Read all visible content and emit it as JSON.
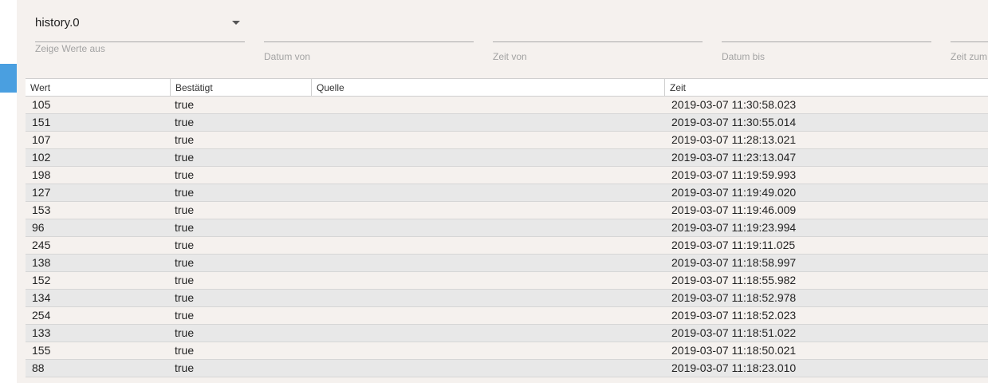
{
  "filters": {
    "history_select": {
      "value": "history.0",
      "label": "Zeige Werte aus"
    },
    "date_from_label": "Datum von",
    "time_from_label": "Zeit von",
    "date_to_label": "Datum bis",
    "time_to_label": "Zeit zum"
  },
  "table": {
    "headers": {
      "wert": "Wert",
      "bestaetigt": "Bestätigt",
      "quelle": "Quelle",
      "zeit": "Zeit"
    },
    "rows": [
      {
        "wert": "105",
        "bestaetigt": "true",
        "quelle": "",
        "zeit": "2019-03-07 11:30:58.023"
      },
      {
        "wert": "151",
        "bestaetigt": "true",
        "quelle": "",
        "zeit": "2019-03-07 11:30:55.014"
      },
      {
        "wert": "107",
        "bestaetigt": "true",
        "quelle": "",
        "zeit": "2019-03-07 11:28:13.021"
      },
      {
        "wert": "102",
        "bestaetigt": "true",
        "quelle": "",
        "zeit": "2019-03-07 11:23:13.047"
      },
      {
        "wert": "198",
        "bestaetigt": "true",
        "quelle": "",
        "zeit": "2019-03-07 11:19:59.993"
      },
      {
        "wert": "127",
        "bestaetigt": "true",
        "quelle": "",
        "zeit": "2019-03-07 11:19:49.020"
      },
      {
        "wert": "153",
        "bestaetigt": "true",
        "quelle": "",
        "zeit": "2019-03-07 11:19:46.009"
      },
      {
        "wert": "96",
        "bestaetigt": "true",
        "quelle": "",
        "zeit": "2019-03-07 11:19:23.994"
      },
      {
        "wert": "245",
        "bestaetigt": "true",
        "quelle": "",
        "zeit": "2019-03-07 11:19:11.025"
      },
      {
        "wert": "138",
        "bestaetigt": "true",
        "quelle": "",
        "zeit": "2019-03-07 11:18:58.997"
      },
      {
        "wert": "152",
        "bestaetigt": "true",
        "quelle": "",
        "zeit": "2019-03-07 11:18:55.982"
      },
      {
        "wert": "134",
        "bestaetigt": "true",
        "quelle": "",
        "zeit": "2019-03-07 11:18:52.978"
      },
      {
        "wert": "254",
        "bestaetigt": "true",
        "quelle": "",
        "zeit": "2019-03-07 11:18:52.023"
      },
      {
        "wert": "133",
        "bestaetigt": "true",
        "quelle": "",
        "zeit": "2019-03-07 11:18:51.022"
      },
      {
        "wert": "155",
        "bestaetigt": "true",
        "quelle": "",
        "zeit": "2019-03-07 11:18:50.021"
      },
      {
        "wert": "88",
        "bestaetigt": "true",
        "quelle": "",
        "zeit": "2019-03-07 11:18:23.010"
      }
    ]
  },
  "colors": {
    "accent": "#4a9fe0",
    "panel_bg": "#f5f1ee",
    "row_alt_bg": "#e8e8e8"
  },
  "icons": {
    "select_caret": "caret-down-icon"
  }
}
